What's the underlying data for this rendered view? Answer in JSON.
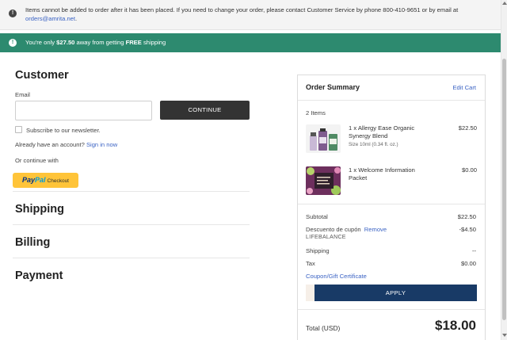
{
  "notice": {
    "icon": "exclamation-icon",
    "text_before": "Items cannot be added to order after it has been placed. If you need to change your order, please contact Customer Service by phone 800-410-9651 or by email at ",
    "email": "orders@amrita.net",
    "text_after": "."
  },
  "shipping_bar": {
    "icon": "exclamation-icon",
    "prefix": "You're only ",
    "amount": "$27.50",
    "middle": " away from getting ",
    "free": "FREE",
    "suffix": " shipping",
    "color": "#2d8a6f"
  },
  "customer": {
    "title": "Customer",
    "email_label": "Email",
    "email_value": "",
    "continue_label": "CONTINUE",
    "newsletter_label": "Subscribe to our newsletter.",
    "account_text": "Already have an account?",
    "sign_in_label": "Sign in now",
    "or_continue": "Or continue with",
    "paypal": {
      "pay": "Pay",
      "pal": "Pal",
      "checkout": "Checkout"
    }
  },
  "sections": {
    "shipping": "Shipping",
    "billing": "Billing",
    "payment": "Payment"
  },
  "summary": {
    "title": "Order Summary",
    "edit_cart": "Edit Cart",
    "items_count": "2 Items",
    "items": [
      {
        "name": "1 x Allergy Ease Organic Synergy Blend",
        "size": "Size 10ml (0.34 fl. oz.)",
        "price": "$22.50"
      },
      {
        "name": "1 x Welcome Information Packet",
        "size": "",
        "price": "$0.00"
      }
    ],
    "subtotal_label": "Subtotal",
    "subtotal_value": "$22.50",
    "discount_label": "Descuento de cupón",
    "remove_label": "Remove",
    "discount_code": "LIFEBALANCE",
    "discount_value": "-$4.50",
    "shipping_label": "Shipping",
    "shipping_value": "--",
    "tax_label": "Tax",
    "tax_value": "$0.00",
    "coupon_link": "Coupon/Gift Certificate",
    "apply_label": "APPLY",
    "total_label": "Total (USD)",
    "total_value": "$18.00"
  }
}
